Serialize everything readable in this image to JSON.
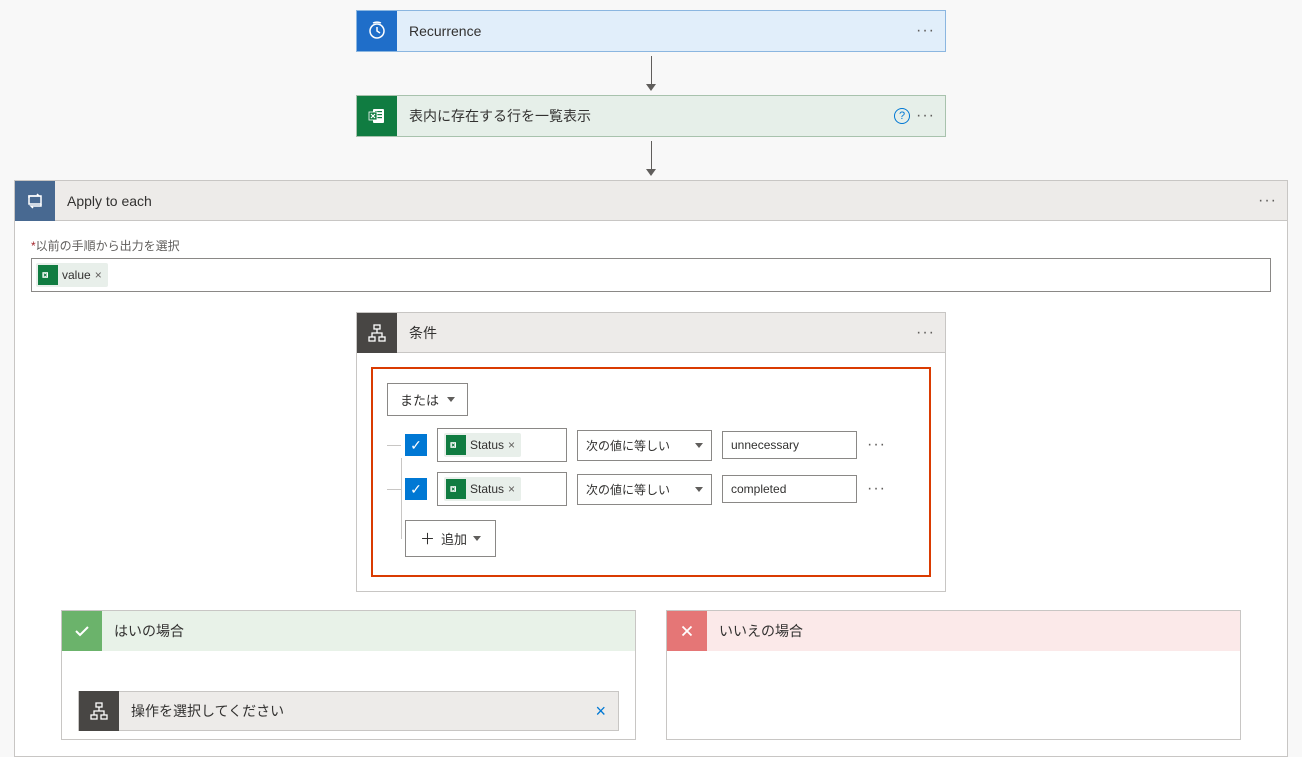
{
  "recurrence": {
    "title": "Recurrence"
  },
  "excel_list": {
    "title": "表内に存在する行を一覧表示"
  },
  "apply_each": {
    "title": "Apply to each",
    "field_label": "以前の手順から出力を選択",
    "token": "value"
  },
  "condition": {
    "title": "条件",
    "group_op": "または",
    "rows": [
      {
        "field_token": "Status",
        "operator": "次の値に等しい",
        "value": "unnecessary"
      },
      {
        "field_token": "Status",
        "operator": "次の値に等しい",
        "value": "completed"
      }
    ],
    "add_label": "追加"
  },
  "branch_yes": {
    "title": "はいの場合"
  },
  "branch_no": {
    "title": "いいえの場合"
  },
  "choose_op": {
    "title": "操作を選択してください"
  }
}
